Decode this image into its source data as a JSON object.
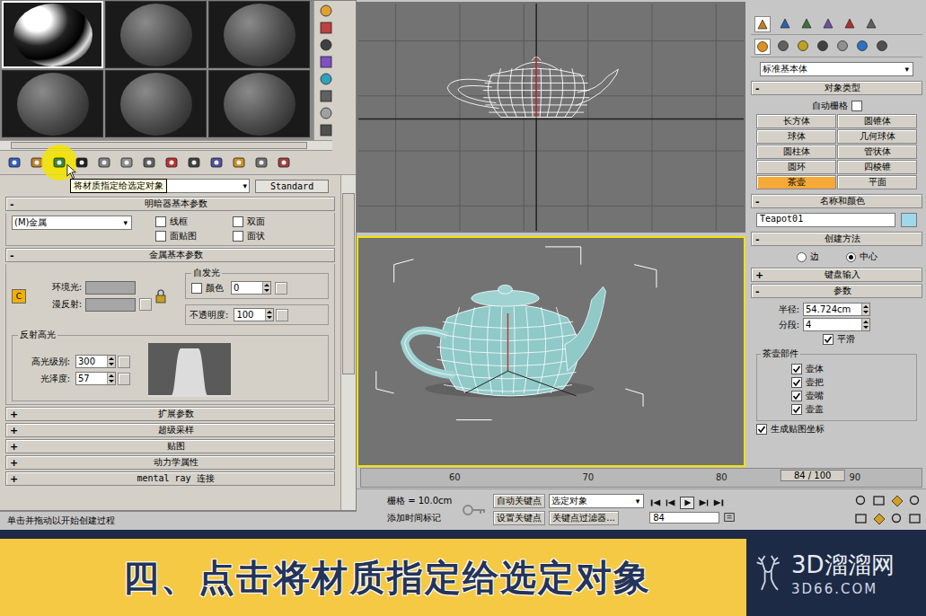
{
  "material_editor": {
    "slots": [
      {
        "selected": true
      },
      {
        "selected": false
      },
      {
        "selected": false
      },
      {
        "selected": false
      },
      {
        "selected": false
      },
      {
        "selected": false
      }
    ],
    "tooltip": "将材质指定给选定对象",
    "material_type": "Standard",
    "shader_params": {
      "sign": "-",
      "title": "明暗器基本参数",
      "shader": "(M)金属",
      "options": [
        {
          "label": "线框",
          "checked": false
        },
        {
          "label": "双面",
          "checked": false
        },
        {
          "label": "面贴图",
          "checked": false
        },
        {
          "label": "面状",
          "checked": false
        }
      ]
    },
    "metal_params": {
      "sign": "-",
      "title": "金属基本参数",
      "lock": "C",
      "ambient": "环境光:",
      "diffuse": "漫反射:",
      "self_illum": {
        "title": "自发光",
        "color_label": "颜色",
        "checked": false,
        "value": "0"
      },
      "opacity": {
        "label": "不透明度:",
        "value": "100"
      },
      "highlights": {
        "title": "反射高光",
        "level_label": "高光级别:",
        "level": "300",
        "gloss_label": "光泽度:",
        "gloss": "57"
      }
    },
    "collapsed": [
      {
        "sign": "+",
        "title": "扩展参数"
      },
      {
        "sign": "+",
        "title": "超级采样"
      },
      {
        "sign": "+",
        "title": "贴图"
      },
      {
        "sign": "+",
        "title": "动力学属性"
      },
      {
        "sign": "+",
        "title": "mental ray 连接"
      }
    ]
  },
  "prompt": "单击并拖动以开始创建过程",
  "viewports": [
    {
      "kind": "wireframe",
      "active": false
    },
    {
      "kind": "shaded",
      "active": true
    }
  ],
  "timeline": {
    "frame_label": "84 / 100",
    "level": 0.84,
    "ticks": [
      "60",
      "70",
      "80",
      "90"
    ]
  },
  "controls": {
    "grid": "栅格 = 10.0cm",
    "time_tag": "添加时间标记",
    "auto_key": "自动关键点",
    "selection": "选定对象",
    "set_key": "设置关键点",
    "key_filters": "关键点过滤器...",
    "frame": "84"
  },
  "command_panel": {
    "category": "标准基本体",
    "object_type": {
      "sign": "-",
      "title": "对象类型",
      "auto_grid": {
        "label": "自动栅格",
        "checked": false
      },
      "buttons": [
        {
          "label": "长方体",
          "selected": false
        },
        {
          "label": "圆锥体",
          "selected": false
        },
        {
          "label": "球体",
          "selected": false
        },
        {
          "label": "几何球体",
          "selected": false
        },
        {
          "label": "圆柱体",
          "selected": false
        },
        {
          "label": "管状体",
          "selected": false
        },
        {
          "label": "圆环",
          "selected": false
        },
        {
          "label": "四棱锥",
          "selected": false
        },
        {
          "label": "茶壶",
          "selected": true
        },
        {
          "label": "平面",
          "selected": false
        }
      ]
    },
    "name_color": {
      "sign": "-",
      "title": "名称和颜色",
      "name": "Teapot01",
      "color": "#9fd8ec"
    },
    "creation_method": {
      "sign": "-",
      "title": "创建方法",
      "options": [
        {
          "label": "边",
          "selected": false
        },
        {
          "label": "中心",
          "selected": true
        }
      ]
    },
    "keyboard": {
      "sign": "+",
      "title": "键盘输入"
    },
    "params": {
      "sign": "-",
      "title": "参数",
      "radius_label": "半径:",
      "radius": "54.724cm",
      "segs_label": "分段:",
      "segs": "4",
      "smooth": {
        "label": "平滑",
        "checked": true
      },
      "parts_title": "茶壶部件",
      "parts": [
        {
          "label": "壶体",
          "checked": true
        },
        {
          "label": "壶把",
          "checked": true
        },
        {
          "label": "壶嘴",
          "checked": true
        },
        {
          "label": "壶盖",
          "checked": true
        }
      ],
      "mapping": {
        "label": "生成贴图坐标",
        "checked": true
      }
    }
  },
  "banner": {
    "title": "四、点击将材质指定给选定对象",
    "logo_name": "3D溜溜网",
    "logo_url": "3D66.COM"
  }
}
